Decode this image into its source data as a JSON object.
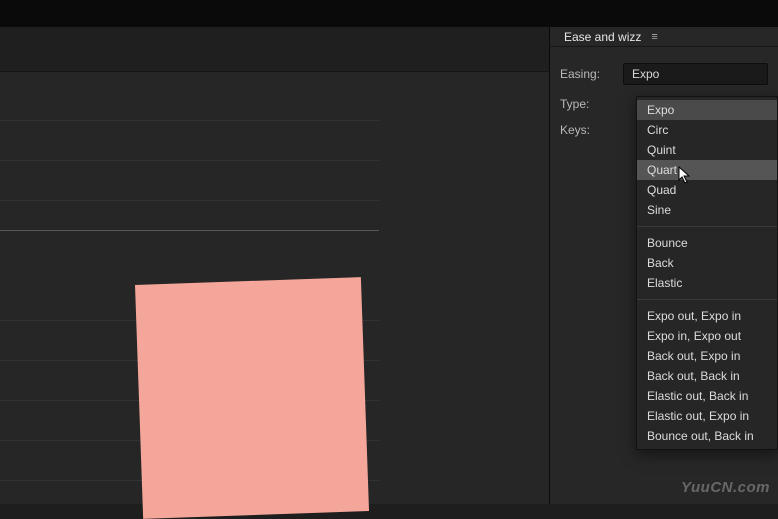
{
  "panel": {
    "title": "Ease and wizz",
    "labels": {
      "easing": "Easing:",
      "type": "Type:",
      "keys": "Keys:"
    },
    "easing_value": "Expo"
  },
  "dropdown": {
    "group1": [
      {
        "label": "Expo",
        "state": "selected"
      },
      {
        "label": "Circ",
        "state": ""
      },
      {
        "label": "Quint",
        "state": ""
      },
      {
        "label": "Quart",
        "state": "hovered"
      },
      {
        "label": "Quad",
        "state": ""
      },
      {
        "label": "Sine",
        "state": ""
      }
    ],
    "group2": [
      {
        "label": "Bounce",
        "state": ""
      },
      {
        "label": "Back",
        "state": ""
      },
      {
        "label": "Elastic",
        "state": ""
      }
    ],
    "group3": [
      {
        "label": "Expo out, Expo in",
        "state": ""
      },
      {
        "label": "Expo in, Expo out",
        "state": ""
      },
      {
        "label": "Back out, Expo in",
        "state": ""
      },
      {
        "label": "Back out, Back in",
        "state": ""
      },
      {
        "label": "Elastic out, Back in",
        "state": ""
      },
      {
        "label": "Elastic out, Expo in",
        "state": ""
      },
      {
        "label": "Bounce out, Back in",
        "state": ""
      }
    ]
  },
  "watermark": "YuuCN.com"
}
